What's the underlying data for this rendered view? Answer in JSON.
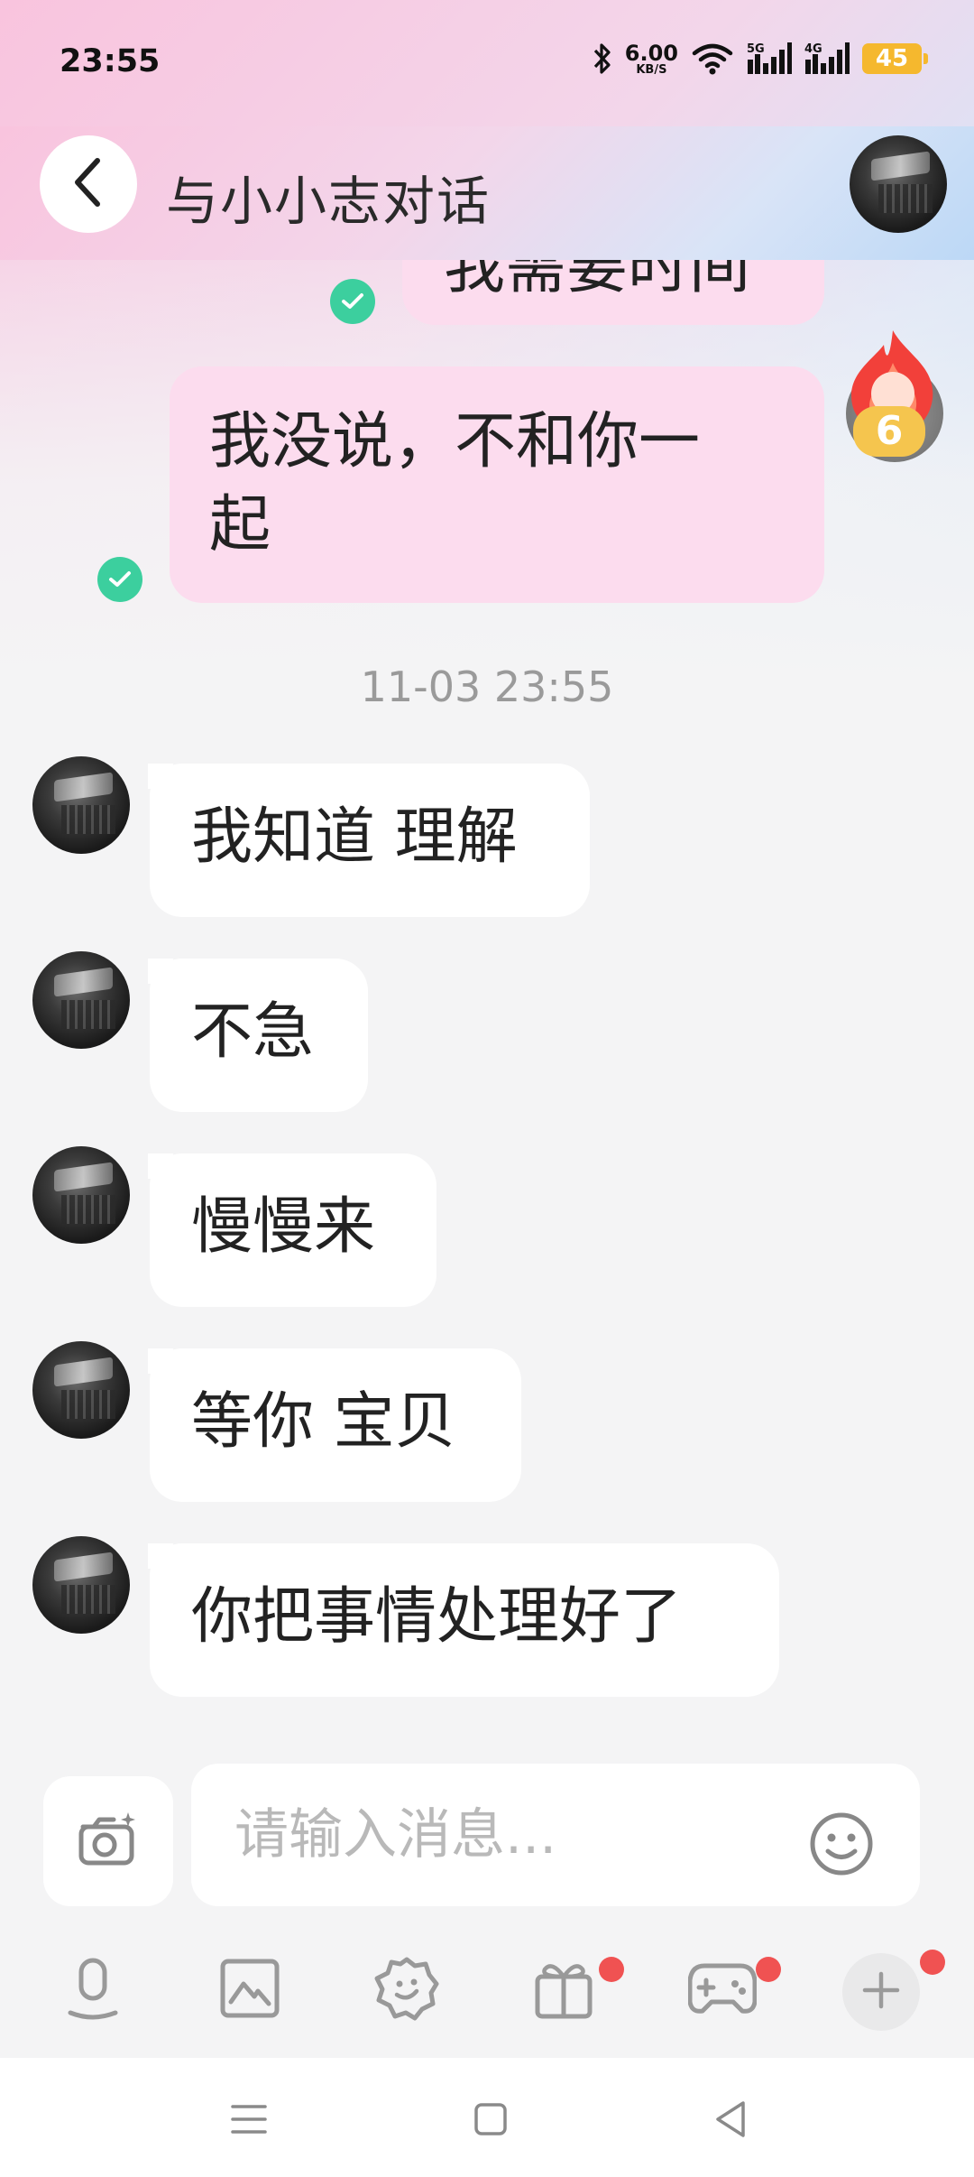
{
  "status_bar": {
    "time": "23:55",
    "net_speed": "6.00",
    "net_speed_unit": "KB/S",
    "signal_1": "5G",
    "signal_2": "4G",
    "battery": "45"
  },
  "header": {
    "title": "与小小志对话",
    "back_icon": "chevron-left-icon"
  },
  "messages_out": [
    {
      "text": "我需要时间",
      "status": "read"
    },
    {
      "text": "我没说，不和你一起",
      "line1": "我没说，不和你一",
      "line2": "起",
      "status": "read"
    }
  ],
  "streak": {
    "count": "6",
    "icon": "fire-icon"
  },
  "timestamp": "11-03 23:55",
  "messages_in": [
    {
      "text": "我知道 理解"
    },
    {
      "text": "不急"
    },
    {
      "text": "慢慢来"
    },
    {
      "text": "等你 宝贝"
    },
    {
      "text": "你把事情处理好了"
    }
  ],
  "composer": {
    "placeholder": "请输入消息...",
    "camera_icon": "camera-icon",
    "emoji_icon": "emoji-icon"
  },
  "toolbar": {
    "items": [
      "microphone-icon",
      "image-icon",
      "sticker-icon",
      "gift-icon",
      "game-icon",
      "plus-icon"
    ]
  },
  "colors": {
    "outgoing_bubble": "#fcdcee",
    "incoming_bubble": "#ffffff",
    "read_check": "#3ccf9e",
    "notification_dot": "#f05252",
    "streak_badge": "#f5c54e"
  }
}
